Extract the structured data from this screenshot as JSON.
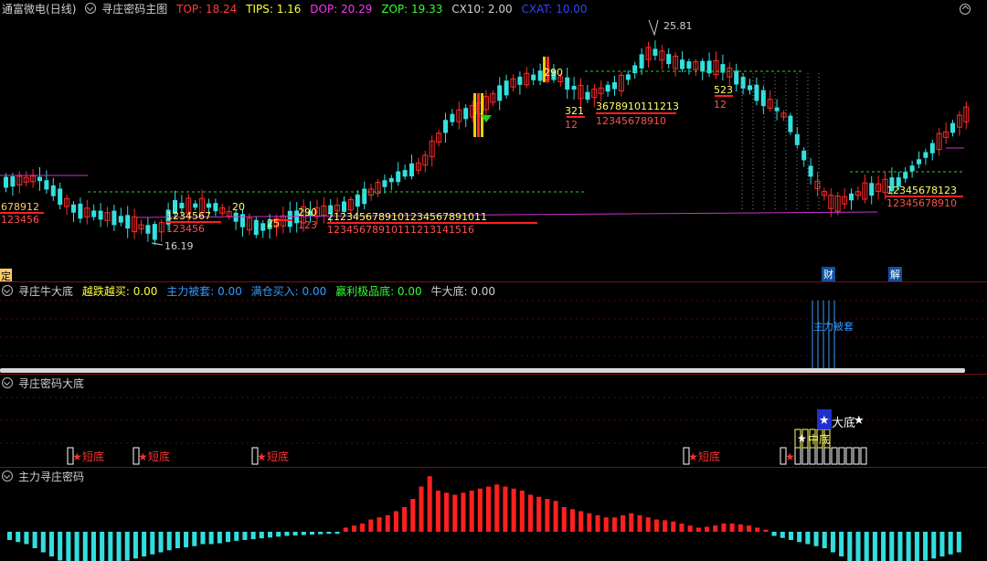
{
  "main_panel": {
    "stock_name": "通富微电",
    "period": "(日线)",
    "indicator_name": "寻庄密码主图",
    "values": [
      {
        "label": "TOP: 18.24",
        "color": "#ff3b3b"
      },
      {
        "label": "TIPS: 1.16",
        "color": "#ffff33"
      },
      {
        "label": "DOP: 20.29",
        "color": "#ff33ff"
      },
      {
        "label": "ZOP: 19.33",
        "color": "#33ff33"
      },
      {
        "label": "CX10: 2.00",
        "color": "#d0d0d0"
      },
      {
        "label": "CXAT: 10.00",
        "color": "#3344ff"
      }
    ],
    "high_label": "25.81",
    "low_label": "16.19",
    "marker_ding": "定",
    "marker_cai": "财",
    "marker_jie": "解",
    "annotations": [
      "678912",
      "123456",
      "1234567",
      "123456",
      "25",
      "20",
      "290",
      "123",
      "2123456789101234567891011",
      "12345678910111213141516",
      "290",
      "321",
      "12",
      "3678910111213",
      "12345678910",
      "523",
      "12",
      "12345678123",
      "12345678910"
    ],
    "colors": {
      "up": "#ff2a2a",
      "down": "#33e0e0",
      "ma_magenta": "#cc33cc",
      "ma_green": "#33cc33"
    }
  },
  "panel_bull": {
    "indicator_name": "寻庄牛大底",
    "values": [
      {
        "label": "越跌越买: 0.00",
        "color": "#ffff33"
      },
      {
        "label": "主力被套: 0.00",
        "color": "#3399ff"
      },
      {
        "label": "满仓买入: 0.00",
        "color": "#3399ff"
      },
      {
        "label": "赢利极品底: 0.00",
        "color": "#33ff33"
      },
      {
        "label": "牛大底: 0.00",
        "color": "#d0d0d0"
      }
    ],
    "overlay_text": "主力被套"
  },
  "panel_bottom": {
    "indicator_name": "寻庄密码大底",
    "short_bottom": "短底",
    "mid_bottom": "中底",
    "big_bottom": "大底"
  },
  "panel_main_force": {
    "indicator_name": "主力寻庄密码",
    "histogram": [
      -0.2,
      -0.25,
      -0.3,
      -0.4,
      -0.5,
      -0.6,
      -0.7,
      -0.8,
      -0.9,
      -1,
      -0.95,
      -0.9,
      -0.85,
      -0.8,
      -0.7,
      -0.65,
      -0.6,
      -0.55,
      -0.5,
      -0.45,
      -0.4,
      -0.38,
      -0.35,
      -0.3,
      -0.3,
      -0.28,
      -0.25,
      -0.22,
      -0.2,
      -0.18,
      -0.16,
      -0.14,
      -0.12,
      -0.1,
      -0.09,
      -0.08,
      -0.07,
      -0.06,
      -0.05,
      -0.05,
      0.1,
      0.15,
      0.2,
      0.3,
      0.35,
      0.4,
      0.5,
      0.6,
      0.8,
      1.1,
      1.35,
      1.0,
      0.95,
      0.9,
      0.95,
      1.0,
      1.05,
      1.1,
      1.15,
      1.1,
      1.05,
      1.0,
      0.9,
      0.85,
      0.8,
      0.75,
      0.6,
      0.55,
      0.5,
      0.45,
      0.4,
      0.35,
      0.35,
      0.4,
      0.45,
      0.4,
      0.35,
      0.3,
      0.28,
      0.25,
      0.2,
      0.15,
      0.1,
      0.12,
      0.15,
      0.2,
      0.2,
      0.18,
      0.15,
      0.1,
      0.05,
      -0.1,
      -0.15,
      -0.2,
      -0.25,
      -0.3,
      -0.35,
      -0.4,
      -0.5,
      -0.6,
      -0.75,
      -0.9,
      -1.1,
      -1.0,
      -0.95,
      -0.9,
      -0.85,
      -0.8,
      -0.75,
      -0.7,
      -0.65,
      -0.6,
      -0.55,
      -0.5
    ]
  }
}
